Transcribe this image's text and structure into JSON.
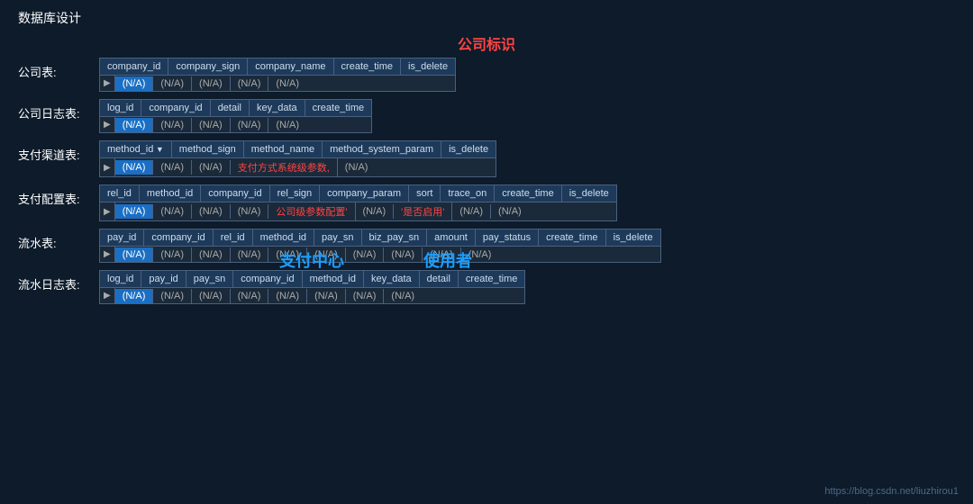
{
  "title": "数据库设计",
  "center_label": "公司标识",
  "watermark": "https://blog.csdn.net/liuzhirou1",
  "tables": [
    {
      "label": "公司表:",
      "headers": [
        "company_id",
        "company_sign",
        "company_name",
        "create_time",
        "is_delete"
      ],
      "highlight_col": 0,
      "cells": [
        "(N/A)",
        "(N/A)",
        "(N/A)",
        "(N/A)",
        "(N/A)"
      ],
      "red_cells": [],
      "has_arrow_header": false
    },
    {
      "label": "公司日志表:",
      "headers": [
        "log_id",
        "company_id",
        "detail",
        "key_data",
        "create_time"
      ],
      "highlight_col": 0,
      "cells": [
        "(N/A)",
        "(N/A)",
        "(N/A)",
        "(N/A)",
        "(N/A)"
      ],
      "red_cells": [],
      "has_arrow_header": false
    },
    {
      "label": "支付渠道表:",
      "headers": [
        "method_id",
        "method_sign",
        "method_name",
        "method_system_param",
        "is_delete"
      ],
      "highlight_col": 0,
      "cells": [
        "(N/A)",
        "(N/A)",
        "(N/A)",
        "支付方式系统级参数,",
        "(N/A)"
      ],
      "red_cells": [
        3
      ],
      "has_arrow_header": true
    },
    {
      "label": "支付配置表:",
      "headers": [
        "rel_id",
        "method_id",
        "company_id",
        "rel_sign",
        "company_param",
        "sort",
        "trace_on",
        "create_time",
        "is_delete"
      ],
      "highlight_col": 0,
      "cells": [
        "(N/A)",
        "(N/A)",
        "(N/A)",
        "(N/A)",
        "公司级参数配置'",
        "(N/A)",
        "'是否启用'",
        "(N/A)",
        "(N/A)"
      ],
      "red_cells": [
        4,
        6
      ],
      "has_arrow_header": false
    },
    {
      "label": "流水表:",
      "headers": [
        "pay_id",
        "company_id",
        "rel_id",
        "method_id",
        "pay_sn",
        "biz_pay_sn",
        "amount",
        "pay_status",
        "create_time",
        "is_delete"
      ],
      "highlight_col": 0,
      "cells": [
        "(N/A)",
        "(N/A)",
        "(N/A)",
        "(N/A)",
        "(N/A)",
        "(N/A)",
        "(N/A)",
        "(N/A)",
        "(N/A)",
        "(N/A)"
      ],
      "red_cells": [],
      "has_arrow_header": false,
      "overlay": true,
      "overlay1": "支付中心",
      "overlay2": "使用者"
    },
    {
      "label": "流水日志表:",
      "headers": [
        "log_id",
        "pay_id",
        "pay_sn",
        "company_id",
        "method_id",
        "key_data",
        "detail",
        "create_time"
      ],
      "highlight_col": 0,
      "cells": [
        "(N/A)",
        "(N/A)",
        "(N/A)",
        "(N/A)",
        "(N/A)",
        "(N/A)",
        "(N/A)",
        "(N/A)"
      ],
      "red_cells": [],
      "has_arrow_header": false
    }
  ]
}
